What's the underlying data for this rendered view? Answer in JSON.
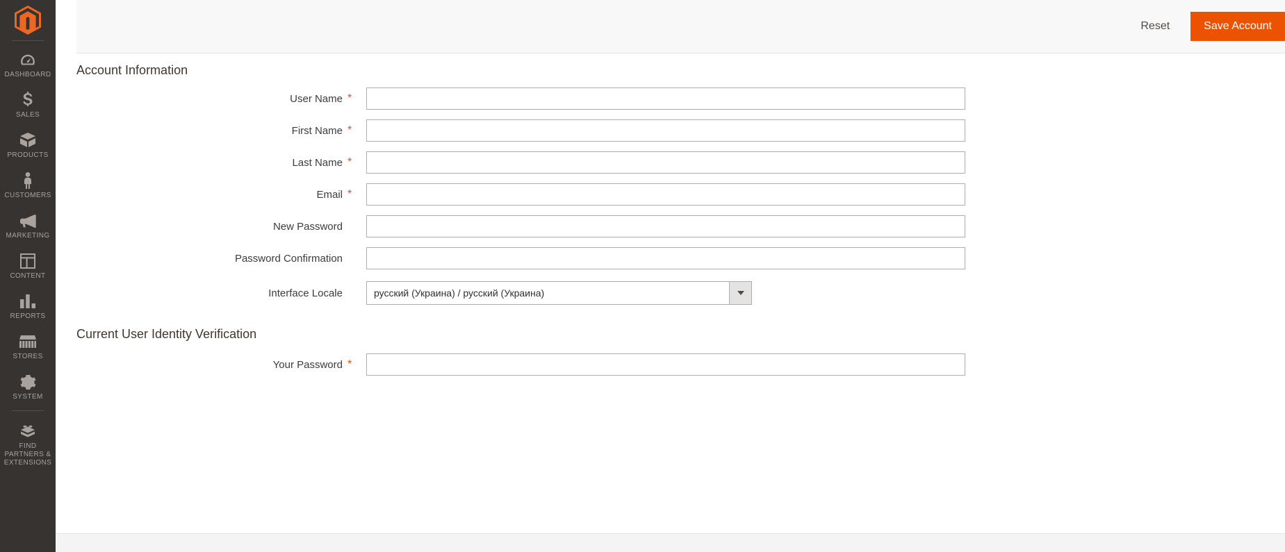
{
  "sidebar": {
    "logo_name": "magento-logo",
    "items": [
      {
        "icon": "dashboard-icon",
        "label": "DASHBOARD"
      },
      {
        "icon": "sales-dollar-icon",
        "label": "SALES"
      },
      {
        "icon": "products-box-icon",
        "label": "PRODUCTS"
      },
      {
        "icon": "customers-person-icon",
        "label": "CUSTOMERS"
      },
      {
        "icon": "marketing-megaphone-icon",
        "label": "MARKETING"
      },
      {
        "icon": "content-layout-icon",
        "label": "CONTENT"
      },
      {
        "icon": "reports-bars-icon",
        "label": "REPORTS"
      },
      {
        "icon": "stores-awning-icon",
        "label": "STORES"
      },
      {
        "icon": "system-gear-icon",
        "label": "SYSTEM"
      },
      {
        "icon": "partners-brick-icon",
        "label": "FIND\nPARTNERS &\nEXTENSIONS"
      }
    ]
  },
  "page_actions": {
    "reset_label": "Reset",
    "save_label": "Save Account",
    "save_color": "#eb5202"
  },
  "sections": {
    "account_information": {
      "title": "Account Information",
      "fields": [
        {
          "label": "User Name",
          "required": true,
          "value": "",
          "type": "text"
        },
        {
          "label": "First Name",
          "required": true,
          "value": "",
          "type": "text"
        },
        {
          "label": "Last Name",
          "required": true,
          "value": "",
          "type": "text"
        },
        {
          "label": "Email",
          "required": true,
          "value": "",
          "type": "text"
        },
        {
          "label": "New Password",
          "required": false,
          "value": "",
          "type": "password"
        },
        {
          "label": "Password Confirmation",
          "required": false,
          "value": "",
          "type": "password"
        }
      ],
      "locale_field": {
        "label": "Interface Locale",
        "required": false,
        "selected": "русский (Украина) / русский (Украина)",
        "arrow_icon": "chevron-down-icon"
      }
    },
    "identity_verification": {
      "title": "Current User Identity Verification",
      "fields": [
        {
          "label": "Your Password",
          "required": true,
          "value": "",
          "type": "password"
        }
      ]
    }
  },
  "colors": {
    "sidebar_bg": "#373330",
    "accent_orange": "#eb5202",
    "required_star": "#e0501a",
    "header_bg": "#f8f8f8"
  }
}
